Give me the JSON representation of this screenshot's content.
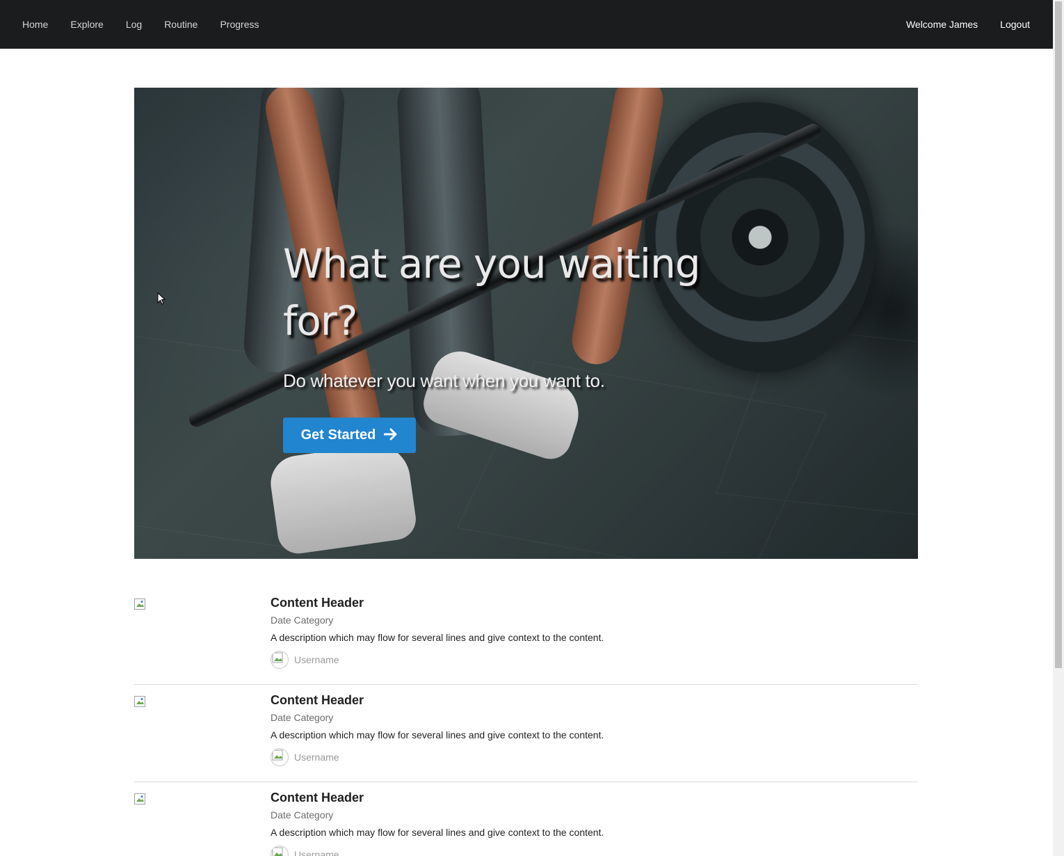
{
  "nav": {
    "left": [
      "Home",
      "Explore",
      "Log",
      "Routine",
      "Progress"
    ],
    "welcome": "Welcome James",
    "logout": "Logout"
  },
  "hero": {
    "title": "What are you waiting for?",
    "subtitle": "Do whatever you want when you want to.",
    "cta_label": "Get Started",
    "cta_icon": "arrow-right-icon",
    "cta_color": "#2185d0"
  },
  "items": [
    {
      "header": "Content Header",
      "meta": "Date Category",
      "description": "A description which may flow for several lines and give context to the content.",
      "username": "Username"
    },
    {
      "header": "Content Header",
      "meta": "Date Category",
      "description": "A description which may flow for several lines and give context to the content.",
      "username": "Username"
    },
    {
      "header": "Content Header",
      "meta": "Date Category",
      "description": "A description which may flow for several lines and give context to the content.",
      "username": "Username"
    }
  ],
  "colors": {
    "navbar_bg": "#1b1c1d",
    "primary": "#2185d0"
  }
}
